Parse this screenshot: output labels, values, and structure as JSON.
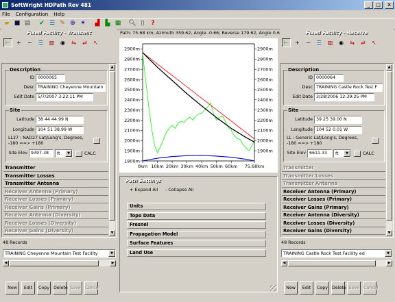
{
  "window": {
    "title": "SoftWright HDPath Rev 481",
    "min": "_",
    "max": "□",
    "close": "×"
  },
  "menu": [
    "File",
    "Configuration",
    "Help"
  ],
  "path_info": "Path: 75.68 km; Azimuth 359.62, Angle -0.66; Reverse 179.62, Angle 0.66",
  "left": {
    "title": "Fixed Facility - Transmit",
    "description": {
      "header": "Description",
      "id_label": "ID",
      "id_value": "0000065",
      "desc_label": "Desc",
      "desc_value": "TRAINING Cheyenne Mountain",
      "date_label": "Edit Date",
      "date_value": "5/7/2007 3:22:11 PM"
    },
    "site": {
      "header": "Site",
      "lat_label": "Latitude",
      "lat_value": "38 44 44.99 N",
      "lon_label": "Longitude",
      "lon_value": "104 51 38.99 W",
      "datum_text": "LL27 : NAD27 Lat/Long's, Degrees, -180 ==> +180",
      "elev_label": "Site Elev",
      "elev_value": "9397.38",
      "elev_unit": "ft",
      "calc_label": "CALC"
    },
    "sections": [
      {
        "label": "Transmitter",
        "enabled": true
      },
      {
        "label": "Transmitter Losses",
        "enabled": true
      },
      {
        "label": "Transmitter Antenna",
        "enabled": true
      },
      {
        "label": "Receiver Antenna (Primary)",
        "enabled": false
      },
      {
        "label": "Receiver Losses (Primary)",
        "enabled": false
      },
      {
        "label": "Receiver Gains (Primary)",
        "enabled": false
      },
      {
        "label": "Receiver Antenna (Diversity)",
        "enabled": false
      },
      {
        "label": "Receiver Losses (Diversity)",
        "enabled": false
      },
      {
        "label": "Receiver Gains (Diversity)",
        "enabled": false
      }
    ],
    "records": "48 Records",
    "facility": "TRAINING Cheyenne Mountain Test Facility",
    "buttons": [
      {
        "label": "New",
        "enabled": true
      },
      {
        "label": "Edit",
        "enabled": true
      },
      {
        "label": "Copy",
        "enabled": true
      },
      {
        "label": "Delete",
        "enabled": true
      },
      {
        "label": "Save",
        "enabled": false
      },
      {
        "label": "Cancel",
        "enabled": false
      }
    ]
  },
  "right": {
    "title": "Fixed Facility - Receive",
    "description": {
      "header": "Description",
      "id_label": "ID",
      "id_value": "0000064",
      "desc_label": "Desc",
      "desc_value": "TRAINING Castle Rock Test F",
      "date_label": "Edit Date",
      "date_value": "3/28/2006 12:39:25 PM"
    },
    "site": {
      "header": "Site",
      "lat_label": "Latitude",
      "lat_value": "39 25 39.00 N",
      "lon_label": "Longitude",
      "lon_value": "104 52 0.01 W",
      "datum_text": "LL : Generic Lat/Long's, Degrees, -180 ==> +180",
      "elev_label": "Site Elev",
      "elev_value": "6611.33",
      "elev_unit": "ft",
      "calc_label": "CALC"
    },
    "sections": [
      {
        "label": "Transmitter",
        "enabled": false
      },
      {
        "label": "Transmitter Losses",
        "enabled": false
      },
      {
        "label": "Transmitter Antenna",
        "enabled": false
      },
      {
        "label": "Receiver Antenna (Primary)",
        "enabled": true
      },
      {
        "label": "Receiver Losses (Primary)",
        "enabled": true
      },
      {
        "label": "Receiver Gains (Primary)",
        "enabled": true
      },
      {
        "label": "Receiver Antenna (Diversity)",
        "enabled": true
      },
      {
        "label": "Receiver Losses (Diversity)",
        "enabled": true
      },
      {
        "label": "Receiver Gains (Diversity)",
        "enabled": true
      }
    ],
    "records": "48 Records",
    "facility": "TRAINING Castle Rock Test Facility ed",
    "buttons": [
      {
        "label": "New",
        "enabled": true
      },
      {
        "label": "Edit",
        "enabled": true
      },
      {
        "label": "Copy",
        "enabled": true
      },
      {
        "label": "Delete",
        "enabled": true
      },
      {
        "label": "Save",
        "enabled": false
      },
      {
        "label": "Cancel",
        "enabled": false
      }
    ]
  },
  "path_settings": {
    "title": "Path Settings",
    "expand_all": "Expand All",
    "collapse_all": "Collapse All",
    "sections": [
      "Units",
      "Topo Data",
      "Fresnel",
      "Propagation Model",
      "Surface Features",
      "Land Use"
    ]
  },
  "colors": {
    "terrain": "#00ff00",
    "earth_curve": "#0000cc",
    "los_red": "#ff0000",
    "los_black": "#000000",
    "title_start": "#0a246a",
    "title_end": "#a6caf0"
  },
  "chart_data": {
    "type": "line",
    "xlabel": "",
    "ylabel": "",
    "x_ticks": [
      "0km",
      "10km",
      "20km",
      "30km",
      "40km",
      "50km",
      "60km",
      "75.68km"
    ],
    "x_tick_values": [
      0,
      10,
      20,
      30,
      40,
      50,
      60,
      75.68
    ],
    "y_left_ticks": [
      "2900m",
      "2800m",
      "2700m",
      "2600m",
      "2500m",
      "2400m",
      "2300m",
      "2200m",
      "2100m",
      "2000m",
      "1900m",
      "1800m"
    ],
    "y_right_ticks": [
      "2900m",
      "2800m",
      "2700m",
      "2600m",
      "2500m",
      "2400m",
      "2300m",
      "2200m",
      "2100m",
      "2000m",
      "1900m"
    ],
    "y_tick_values": [
      2900,
      2800,
      2700,
      2600,
      2500,
      2400,
      2300,
      2200,
      2100,
      2000,
      1900,
      1800
    ],
    "xlim": [
      0,
      75.68
    ],
    "ylim": [
      1800,
      2950
    ],
    "series": [
      {
        "key": "los_red",
        "x": [
          0,
          75.68
        ],
        "y": [
          2864,
          2015
        ]
      },
      {
        "key": "los_black",
        "x": [
          0,
          10,
          20,
          30,
          40,
          50,
          60,
          70,
          75.68
        ],
        "y": [
          2864,
          2720,
          2590,
          2460,
          2340,
          2225,
          2120,
          2030,
          1985
        ]
      },
      {
        "key": "terrain",
        "x": [
          0,
          2,
          4,
          6,
          8,
          10,
          12,
          14,
          16,
          18,
          20,
          22,
          24,
          26,
          28,
          30,
          32,
          34,
          36,
          38,
          40,
          42,
          44,
          46,
          48,
          50,
          52,
          54,
          56,
          58,
          60,
          62,
          64,
          66,
          68,
          70,
          72,
          74,
          75.68
        ],
        "y": [
          2850,
          2600,
          2350,
          2130,
          1960,
          1880,
          1940,
          2010,
          2080,
          2120,
          2150,
          2120,
          2170,
          2190,
          2180,
          2210,
          2230,
          2200,
          2240,
          2260,
          2270,
          2300,
          2330,
          2370,
          2260,
          2200,
          2230,
          2240,
          2190,
          2130,
          2100,
          2050,
          2020,
          2010,
          1960,
          1930,
          1900,
          1950,
          2000
        ]
      },
      {
        "key": "earth_curve",
        "x": [
          0,
          10,
          20,
          30,
          40,
          50,
          60,
          70,
          75.68
        ],
        "y": [
          1800,
          1826,
          1843,
          1852,
          1854,
          1848,
          1836,
          1816,
          1800
        ]
      }
    ]
  }
}
